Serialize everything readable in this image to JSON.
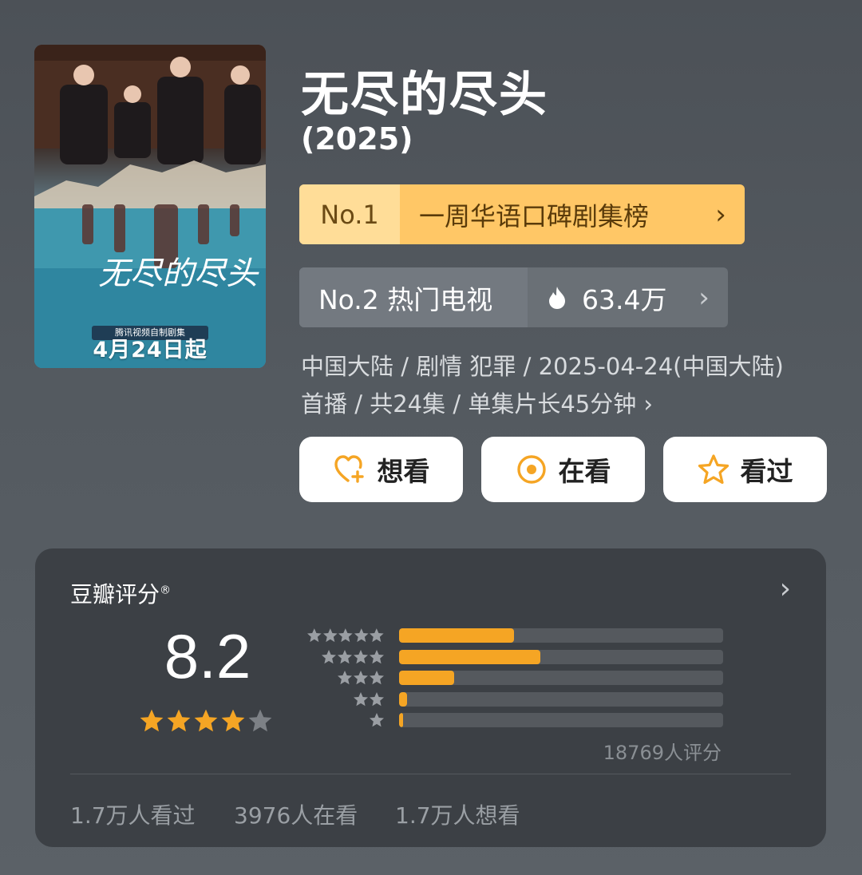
{
  "poster": {
    "date_text": "4月24日起",
    "badge_text": "腾讯视频自制剧集",
    "logo_text": "无尽的尽头"
  },
  "title": "无尽的尽头",
  "year": "(2025)",
  "rank_primary": {
    "number": "No.1",
    "label": "一周华语口碑剧集榜",
    "chevron": "›"
  },
  "rank_secondary": {
    "number": "No.2 热门电视",
    "heat": "63.4万",
    "chevron": "›"
  },
  "meta": {
    "line1": "中国大陆 / 剧情 犯罪 / 2025-04-24(中国大陆)",
    "line2": "首播 / 共24集 / 单集片长45分钟 ›"
  },
  "actions": {
    "want": "想看",
    "watching": "在看",
    "watched": "看过"
  },
  "rating": {
    "title": "豆瓣评分",
    "registered": "®",
    "score": "8.2",
    "stars": 4,
    "max_stars": 5,
    "distribution": [
      {
        "stars": 5,
        "fraction": 0.355
      },
      {
        "stars": 4,
        "fraction": 0.435
      },
      {
        "stars": 3,
        "fraction": 0.17
      },
      {
        "stars": 2,
        "fraction": 0.025
      },
      {
        "stars": 1,
        "fraction": 0.012
      }
    ],
    "count": "18769人评分",
    "watched": "1.7万人看过",
    "watching": "3976人在看",
    "want": "1.7万人想看"
  },
  "colors": {
    "accent": "#f5a524",
    "rank_gold": "#ffc766"
  }
}
